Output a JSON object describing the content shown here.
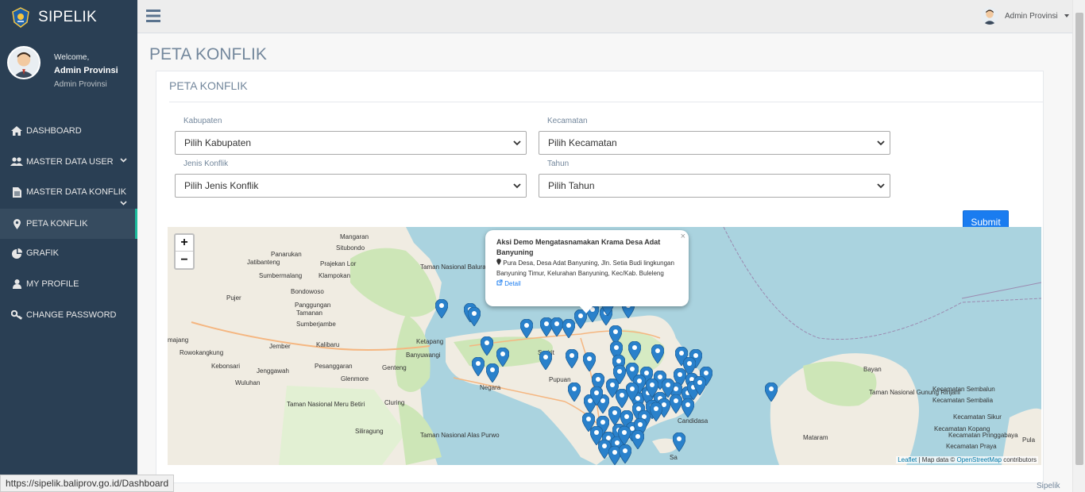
{
  "app": {
    "name": "SIPELIK"
  },
  "sidebar": {
    "welcome": "Welcome,",
    "user_name": "Admin Provinsi",
    "user_role": "Admin Provinsi",
    "items": [
      {
        "label": "DASHBOARD",
        "icon": "home-icon"
      },
      {
        "label": "MASTER DATA USER",
        "icon": "users-icon"
      },
      {
        "label": "MASTER DATA KONFLIK",
        "icon": "file-icon"
      },
      {
        "label": "PETA KONFLIK",
        "icon": "map-marker-icon",
        "active": true
      },
      {
        "label": "GRAFIK",
        "icon": "pie-chart-icon"
      },
      {
        "label": "MY PROFILE",
        "icon": "user-icon"
      },
      {
        "label": "CHANGE PASSWORD",
        "icon": "key-icon"
      }
    ]
  },
  "topnav": {
    "user_label": "Admin Provinsi"
  },
  "page": {
    "title": "PETA KONFLIK"
  },
  "panel": {
    "title": "PETA KONFLIK"
  },
  "filters": {
    "kabupaten": {
      "label": "Kabupaten",
      "value": "Pilih Kabupaten"
    },
    "kecamatan": {
      "label": "Kecamatan",
      "value": "Pilih Kecamatan"
    },
    "jenis": {
      "label": "Jenis Konflik",
      "value": "Pilih Jenis Konflik"
    },
    "tahun": {
      "label": "Tahun",
      "value": "Pilih Tahun"
    },
    "submit_label": "Submit"
  },
  "map": {
    "zoom_in": "+",
    "zoom_out": "−",
    "popup": {
      "title": "Aksi Demo Mengatasnamakan Krama Desa Adat Banyuning",
      "address": "Pura Desa, Desa Adat Banyuning, Jln. Setia Budi lingkungan Banyuning Timur, Kelurahan Banyuning, Kec/Kab. Buleleng",
      "detail": "Detail",
      "close": "×"
    },
    "attribution": {
      "leaflet": "Leaflet",
      "sep": " | Map data © ",
      "osm": "OpenStreetMap",
      "tail": " contributors"
    },
    "places": [
      "Mangaran",
      "Situbondo",
      "Panarukan",
      "Jatibanteng",
      "Prajekan Lor",
      "Taman Nasional Baluran",
      "Sumbermalang",
      "Klampokan",
      "Bondowoso",
      "Pujer",
      "Panggungan",
      "Tamanan",
      "Sumberjambe",
      "majang",
      "Jember",
      "Kalibaru",
      "Banyuwangi",
      "Ketapang",
      "Rowokangkung",
      "Kebonsari",
      "Pesanggaran",
      "Jenggawah",
      "Wuluhan",
      "Genteng",
      "Glenmore",
      "Cluring",
      "Taman Nasional Meru Betiri",
      "Siliragung",
      "Taman Nasional Alas Purwo",
      "Seririt",
      "Negara",
      "Pupuan",
      "Candidasa",
      "Bayan",
      "Kecamatan Sembalun",
      "Kecamatan Sembalia",
      "Taman Nasional Gunung Rinjani",
      "Kecamatan Sikur",
      "Mataram",
      "Kecamatan Pringgabaya",
      "Kecamatan Praya",
      "Kecamatan Kopang",
      "Pula",
      "Sa"
    ],
    "pin_color": "#2a81cb"
  },
  "statusbar": {
    "url": "https://sipelik.baliprov.go.id/Dashboard"
  },
  "footer": {
    "brand": "Sipelik"
  }
}
